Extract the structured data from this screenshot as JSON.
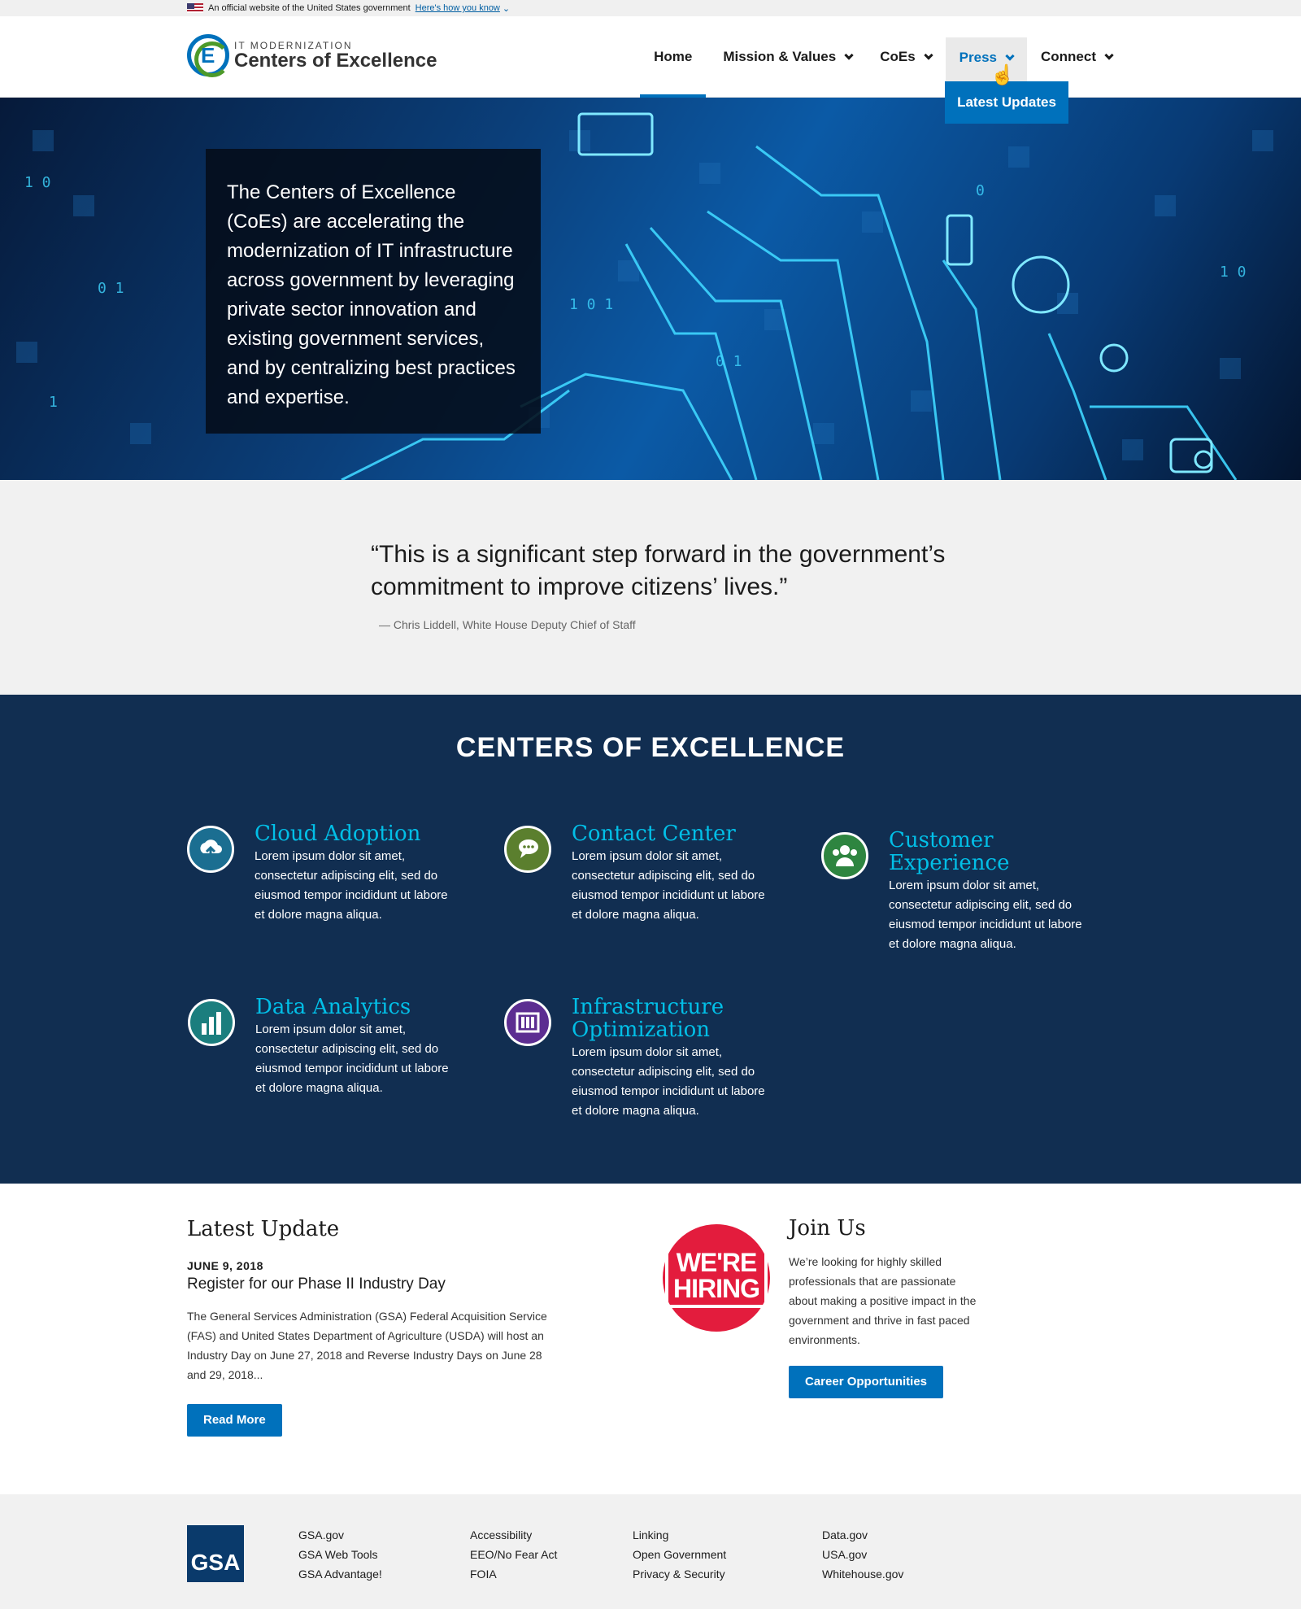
{
  "gov_banner": {
    "text": "An official website of the United States government",
    "link": "Here's how you know"
  },
  "logo": {
    "small": "IT MODERNIZATION",
    "big": "Centers of Excellence",
    "mark": "E"
  },
  "nav": {
    "items": [
      {
        "label": "Home"
      },
      {
        "label": "Mission & Values"
      },
      {
        "label": "CoEs"
      },
      {
        "label": "Press"
      },
      {
        "label": "Connect"
      }
    ],
    "dropdown_item": "Latest Updates"
  },
  "hero": {
    "text": "The Centers of Excellence (CoEs) are accelerating the modernization of IT infrastructure across government by leveraging private sector innovation and existing government services, and by centralizing best practices and expertise."
  },
  "quote": {
    "text": "“This is a significant step forward in the government’s commitment to improve citizens’ lives.”",
    "author": "— Chris Liddell, White House Deputy Chief of Staff"
  },
  "coe": {
    "title": "CENTERS OF EXCELLENCE",
    "items": [
      {
        "name": "Cloud Adoption",
        "desc": "Lorem ipsum dolor sit amet, consectetur adipiscing elit, sed do eiusmod tempor incididunt ut labore et dolore magna aliqua.",
        "icon": "cloud-upload-icon",
        "color": "#1b6e91"
      },
      {
        "name": "Contact Center",
        "desc": "Lorem ipsum dolor sit amet, consectetur adipiscing elit, sed do eiusmod tempor incididunt ut labore et dolore magna aliqua.",
        "icon": "chat-bubbles-icon",
        "color": "#5b7f2e"
      },
      {
        "name": "Customer Experience",
        "desc": "Lorem ipsum dolor sit amet, consectetur adipiscing elit, sed do eiusmod tempor incididunt ut labore et dolore magna aliqua.",
        "icon": "people-group-icon",
        "color": "#2e8540"
      },
      {
        "name": "Data Analytics",
        "desc": "Lorem ipsum dolor sit amet, consectetur adipiscing elit, sed do eiusmod tempor incididunt ut labore et dolore magna aliqua.",
        "icon": "bar-chart-icon",
        "color": "#1b7e7e"
      },
      {
        "name": "Infrastructure Optimization",
        "desc": "Lorem ipsum dolor sit amet, consectetur adipiscing elit, sed do eiusmod tempor incididunt ut labore et dolore magna aliqua.",
        "icon": "server-rack-icon",
        "color": "#5c2d91"
      }
    ]
  },
  "latest": {
    "heading": "Latest Update",
    "date": "JUNE 9, 2018",
    "title": "Register for our Phase II Industry Day",
    "text": "The General Services Administration (GSA) Federal Acquisition Service (FAS) and United States Department of Agriculture (USDA) will host an Industry Day on June 27, 2018 and Reverse Industry Days on June 28 and 29, 2018...",
    "button": "Read More"
  },
  "join": {
    "badge_line1": "WE'RE",
    "badge_line2": "HIRING",
    "heading": "Join Us",
    "text": "We’re looking for highly skilled professionals that are passionate about making a positive impact in the government and thrive in fast paced environments.",
    "button": "Career Opportunities"
  },
  "footer": {
    "logo": "GSA",
    "columns": [
      [
        "GSA.gov",
        "GSA Web Tools",
        "GSA Advantage!"
      ],
      [
        "Accessibility",
        "EEO/No Fear Act",
        "FOIA"
      ],
      [
        "Linking",
        "Open Government",
        "Privacy & Security"
      ],
      [
        "Data.gov",
        "USA.gov",
        "Whitehouse.gov"
      ]
    ]
  }
}
